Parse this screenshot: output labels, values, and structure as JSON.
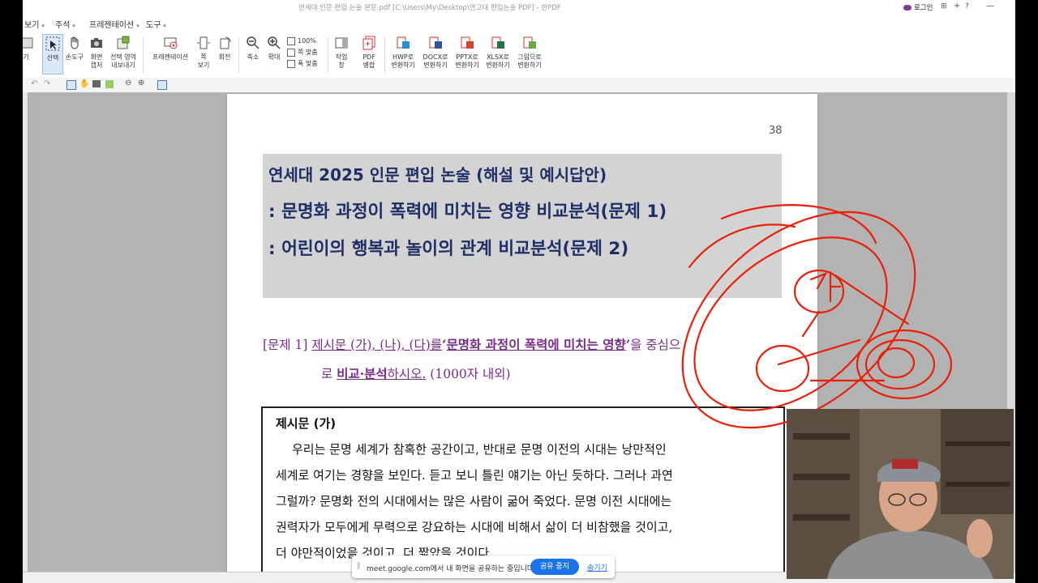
{
  "window": {
    "title": "연세대 인문 편입 논술 본문.pdf [C:\\Users\\My\\Desktop\\연고대 편입논술 PDF] - 한PDF",
    "login_label": "로그인",
    "title_icons": [
      "+",
      "?"
    ]
  },
  "menu": {
    "items": [
      "보기",
      "주석",
      "프레젠테이션",
      "도구"
    ]
  },
  "ribbon": {
    "tools": [
      {
        "label": "기",
        "icon": "partial-tool-icon"
      },
      {
        "label": "선택",
        "icon": "select-cursor-icon",
        "active": true
      },
      {
        "label": "손도구",
        "icon": "hand-icon"
      },
      {
        "label": "화면\n캡처",
        "icon": "camera-icon"
      },
      {
        "label": "선택 영역\n내보내기",
        "icon": "export-area-icon"
      },
      {
        "label": "프레젠테이션",
        "icon": "presentation-icon"
      },
      {
        "label": "쪽\n보기",
        "icon": "page-view-icon"
      },
      {
        "label": "회전",
        "icon": "rotate-icon"
      },
      {
        "label": "축소",
        "icon": "zoom-out-icon"
      },
      {
        "label": "확대",
        "icon": "zoom-in-icon"
      },
      {
        "label": "작업\n창",
        "icon": "work-pane-icon"
      },
      {
        "label": "PDF\n병합",
        "icon": "pdf-merge-icon"
      },
      {
        "label": "HWP로\n변환하기",
        "icon": "hwp-convert-icon"
      },
      {
        "label": "DOCX로\n변환하기",
        "icon": "docx-convert-icon"
      },
      {
        "label": "PPTX로\n변환하기",
        "icon": "pptx-convert-icon"
      },
      {
        "label": "XLSX로\n변환하기",
        "icon": "xlsx-convert-icon"
      },
      {
        "label": "그림으로\n변환하기",
        "icon": "image-convert-icon"
      }
    ],
    "zoom_options": [
      "100%",
      "쪽 맞춤",
      "폭 맞춤"
    ]
  },
  "document": {
    "page_number": "38",
    "title_lines": [
      "연세대 2025 인문 편입 논술 (해설 및 예시답안)",
      ": 문명화 과정이 폭력에 미치는 영향 비교분석(문제 1)",
      ": 어린이의 행복과 놀이의 관계 비교분석(문제 2)"
    ],
    "question": {
      "prefix": "[문제 1]",
      "part1": "제시문 (가), (나), (다)를",
      "quote_open": "‘",
      "highlight": "문명화 과정이 폭력에 미치는 영향",
      "quote_close": "’",
      "part2": "을 중심으",
      "line2_part1": "로",
      "line2_highlight": "비교·분석",
      "line2_part2": "하시오.",
      "line2_limit": "(1000자 내외)"
    },
    "passage": {
      "heading": "제시문 (가)",
      "lines": [
        "우리는 문명 세계가 참혹한 공간이고, 반대로 문명 이전의 시대는 낭만적인",
        "세계로 여기는 경향을 보인다. 듣고 보니 틀린 얘기는 아닌 듯하다. 그러나 과연",
        "그럴까? 문명화 전의 시대에서는 많은 사람이 굶어 죽었다. 문명 이전 시대에는",
        "권력자가 모두에게 무력으로 강요하는 시대에 비해서 삶이 더 비참했을 것이고,",
        "더 야만적이었을 것이고, 더 짧았을 것이다."
      ]
    }
  },
  "screen_share": {
    "message": "meet.google.com에서 내 화면을 공유하는 중입니다.",
    "stop_label": "공유 중지",
    "hide_label": "숨기기"
  },
  "colors": {
    "title_text": "#1f2f66",
    "question_text": "#7a2a8a",
    "title_box": "#d3d3d3",
    "annotation_red": "#e8200a",
    "share_button": "#1a73e8"
  }
}
